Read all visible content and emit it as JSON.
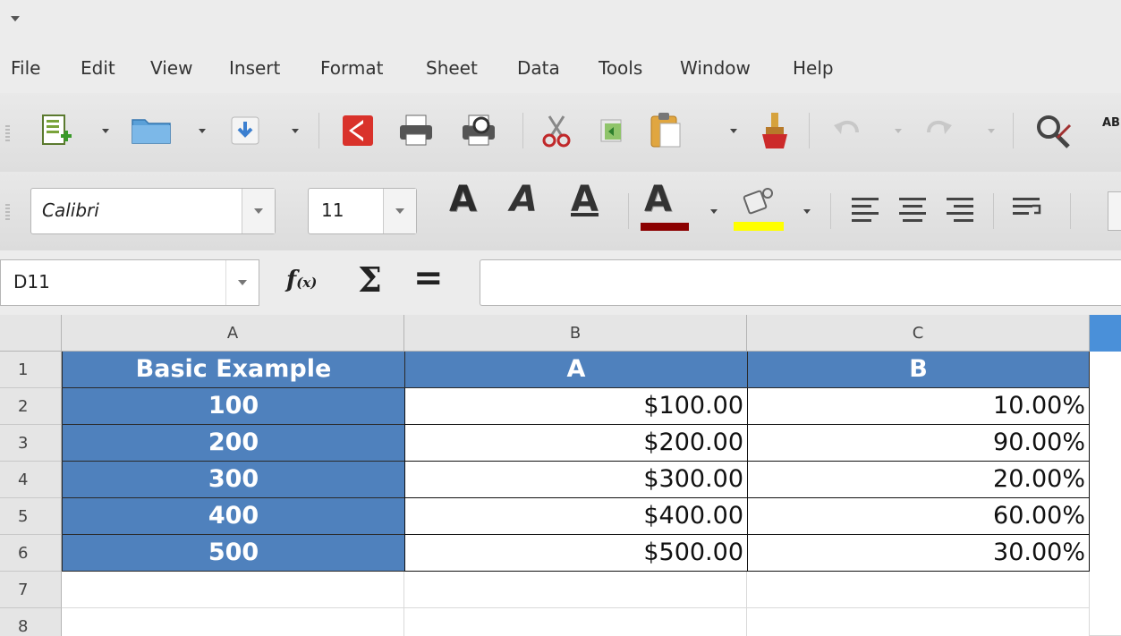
{
  "menu": [
    "File",
    "Edit",
    "View",
    "Insert",
    "Format",
    "Sheet",
    "Data",
    "Tools",
    "Window",
    "Help"
  ],
  "toolbar": {
    "icons": [
      "new-spreadsheet-icon",
      "open-folder-icon",
      "save-icon",
      "export-pdf-icon",
      "print-icon",
      "print-preview-icon",
      "cut-icon",
      "copy-icon",
      "paste-icon",
      "clone-formatting-icon",
      "undo-icon",
      "redo-icon",
      "spellcheck-icon"
    ],
    "overflow_label": "AB"
  },
  "format": {
    "font_name": "Calibri",
    "font_size": "11",
    "bold_label": "A",
    "italic_label": "A",
    "underline_label": "A",
    "font_color_label": "A",
    "font_color": "#8b0000",
    "highlight_color": "#ffff00"
  },
  "formula": {
    "cell_ref": "D11",
    "fx_main": "f",
    "fx_sub": "(x)",
    "sigma": "Σ",
    "equals": "=",
    "content": ""
  },
  "sheet": {
    "columns": [
      "A",
      "B",
      "C"
    ],
    "rows": [
      "1",
      "2",
      "3",
      "4",
      "5",
      "6",
      "7",
      "8"
    ],
    "header": [
      "Basic Example",
      "A",
      "B"
    ],
    "data": [
      [
        "100",
        "$100.00",
        "10.00%"
      ],
      [
        "200",
        "$200.00",
        "90.00%"
      ],
      [
        "300",
        "$300.00",
        "20.00%"
      ],
      [
        "400",
        "$400.00",
        "60.00%"
      ],
      [
        "500",
        "$500.00",
        "30.00%"
      ]
    ],
    "accent": "#4f81bd"
  }
}
